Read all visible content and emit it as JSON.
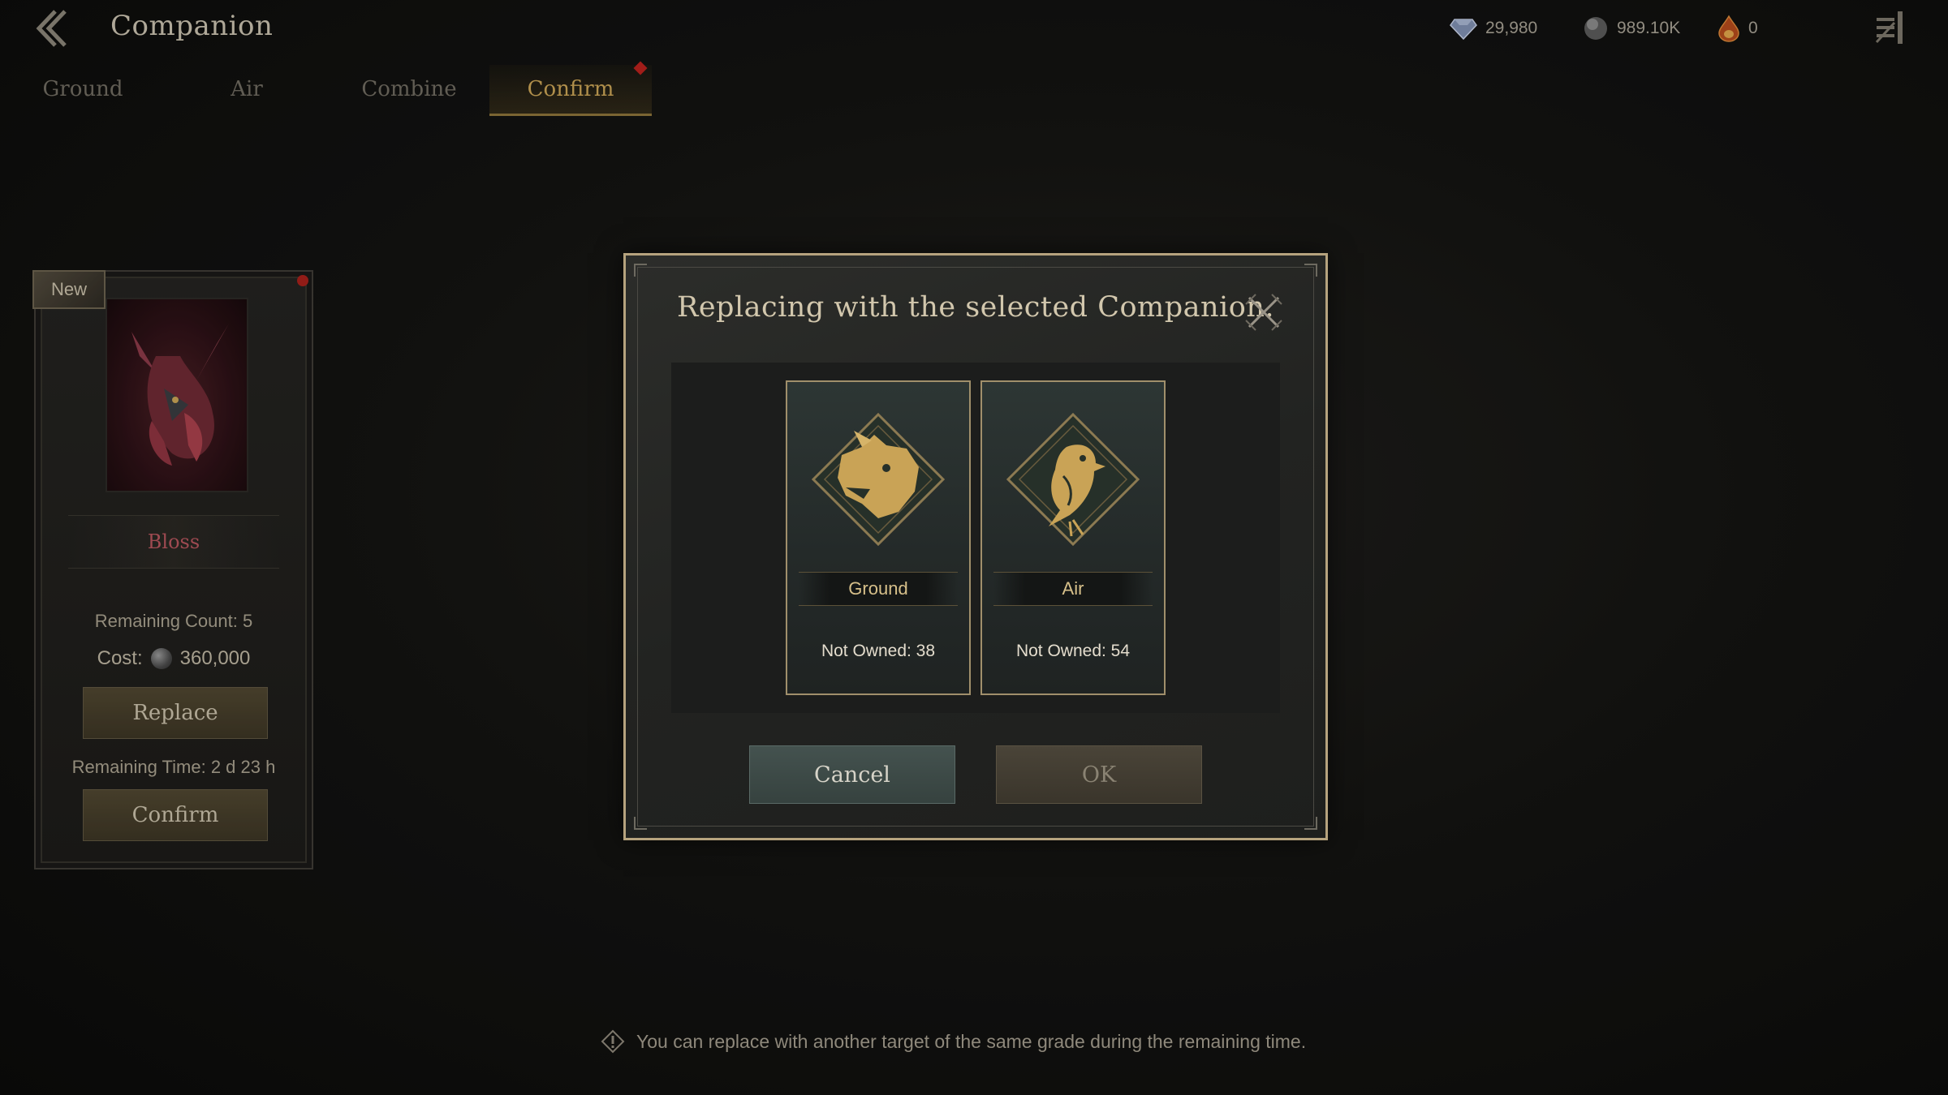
{
  "header": {
    "title": "Companion"
  },
  "currencies": [
    {
      "icon": "diamond-icon",
      "value": "29,980"
    },
    {
      "icon": "stone-icon",
      "value": "989.10K"
    },
    {
      "icon": "flame-drop-icon",
      "value": "0"
    }
  ],
  "tabs": [
    {
      "label": "Ground",
      "active": false
    },
    {
      "label": "Air",
      "active": false
    },
    {
      "label": "Combine",
      "active": false
    },
    {
      "label": "Confirm",
      "active": true,
      "notification": true
    }
  ],
  "companion_card": {
    "badge": "New",
    "name": "Bloss",
    "remaining_count": "Remaining Count: 5",
    "cost_label": "Cost:",
    "cost_value": "360,000",
    "replace_label": "Replace",
    "remaining_time": "Remaining Time: 2 d 23 h",
    "confirm_label": "Confirm"
  },
  "dialog": {
    "title": "Replacing with the selected Companion.",
    "options": [
      {
        "label": "Ground",
        "count": "Not Owned: 38",
        "icon": "wolf-emblem-icon"
      },
      {
        "label": "Air",
        "count": "Not Owned: 54",
        "icon": "raven-emblem-icon"
      }
    ],
    "cancel_label": "Cancel",
    "ok_label": "OK"
  },
  "notice": {
    "text": "You can replace with another target of the same grade during the remaining time."
  },
  "colors": {
    "accent_gold": "#c9a356",
    "notification_red": "#b8211d",
    "companion_name": "#b5555d"
  }
}
